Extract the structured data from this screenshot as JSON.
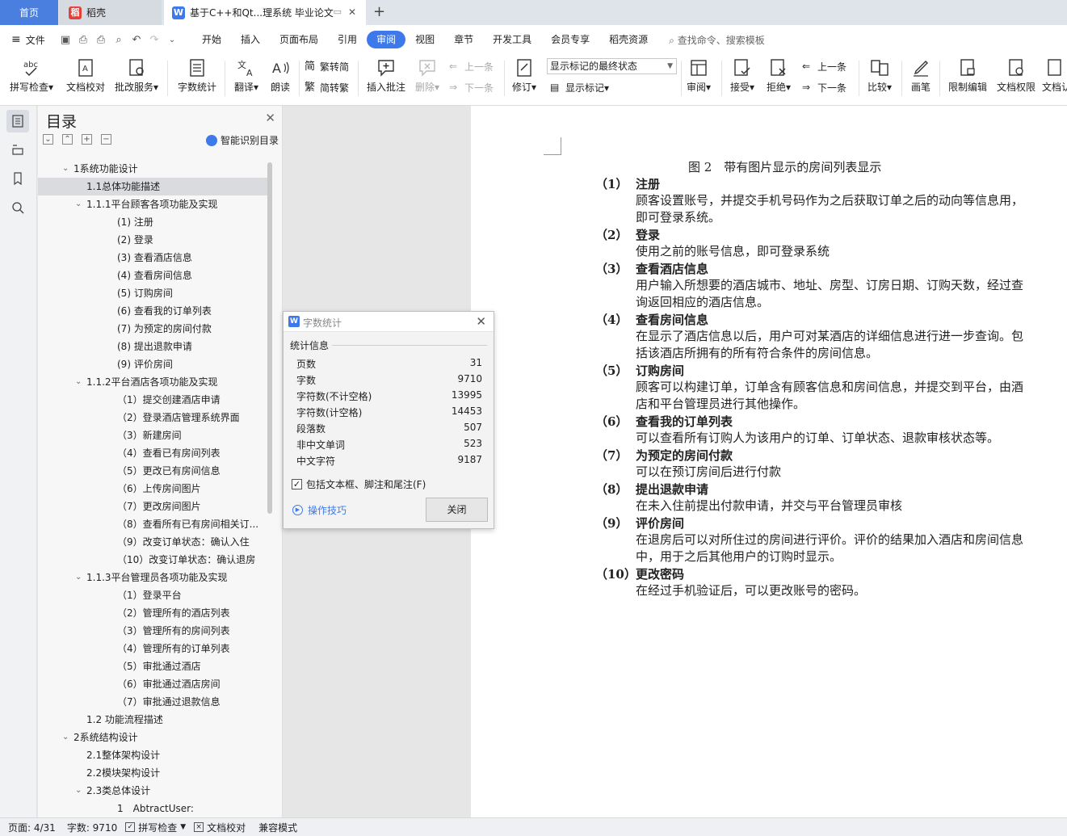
{
  "tabs": {
    "home": "首页",
    "daoke": "稻壳",
    "doc": "基于C++和Qt...理系统 毕业论文"
  },
  "menu": {
    "file": "文件",
    "tabs": [
      "开始",
      "插入",
      "页面布局",
      "引用",
      "审阅",
      "视图",
      "章节",
      "开发工具",
      "会员专享",
      "稻壳资源"
    ],
    "active_tab": "审阅",
    "search": "查找命令、搜索模板"
  },
  "ribbon": {
    "spellcheck": "拼写检查",
    "proofread": "文档校对",
    "annotate_service": "批改服务",
    "word_count": "字数统计",
    "translate": "翻译",
    "read_aloud": "朗读",
    "to_traditional": "繁转简",
    "to_simplified": "简转繁",
    "insert_comment": "插入批注",
    "delete": "删除",
    "prev": "上一条",
    "next": "下一条",
    "track": "修订",
    "markup_state": "显示标记的最终状态",
    "show_markup": "显示标记",
    "review": "审阅",
    "accept": "接受",
    "reject": "拒绝",
    "prev2": "上一条",
    "next2": "下一条",
    "compare": "比较",
    "pen": "画笔",
    "restrict": "限制编辑",
    "permission": "文档权限",
    "doc_more": "文档认"
  },
  "nav": {
    "title": "目录",
    "smart": "智能识别目录",
    "items": [
      {
        "text": "1系统功能设计",
        "level": 0,
        "toggle": "v"
      },
      {
        "text": "1.1总体功能描述",
        "level": 1,
        "toggle": "",
        "selected": true
      },
      {
        "text": "1.1.1平台顾客各项功能及实现",
        "level": 1,
        "toggle": "v"
      },
      {
        "text": "(1) 注册",
        "level": 2,
        "toggle": ""
      },
      {
        "text": "(2) 登录",
        "level": 2,
        "toggle": ""
      },
      {
        "text": "(3) 查看酒店信息",
        "level": 2,
        "toggle": ""
      },
      {
        "text": "(4) 查看房间信息",
        "level": 2,
        "toggle": ""
      },
      {
        "text": "(5) 订购房间",
        "level": 2,
        "toggle": ""
      },
      {
        "text": "(6) 查看我的订单列表",
        "level": 2,
        "toggle": ""
      },
      {
        "text": "(7) 为预定的房间付款",
        "level": 2,
        "toggle": ""
      },
      {
        "text": "(8) 提出退款申请",
        "level": 2,
        "toggle": ""
      },
      {
        "text": "(9) 评价房间",
        "level": 2,
        "toggle": ""
      },
      {
        "text": "1.1.2平台酒店各项功能及实现",
        "level": 1,
        "toggle": "v"
      },
      {
        "text": "（1）提交创建酒店申请",
        "level": 2,
        "toggle": ""
      },
      {
        "text": "（2）登录酒店管理系统界面",
        "level": 2,
        "toggle": ""
      },
      {
        "text": "（3）新建房间",
        "level": 2,
        "toggle": ""
      },
      {
        "text": "（4）查看已有房间列表",
        "level": 2,
        "toggle": ""
      },
      {
        "text": "（5）更改已有房间信息",
        "level": 2,
        "toggle": ""
      },
      {
        "text": "（6）上传房间图片",
        "level": 2,
        "toggle": ""
      },
      {
        "text": "（7）更改房间图片",
        "level": 2,
        "toggle": ""
      },
      {
        "text": "（8）查看所有已有房间相关订...",
        "level": 2,
        "toggle": ""
      },
      {
        "text": "（9）改变订单状态：确认入住",
        "level": 2,
        "toggle": ""
      },
      {
        "text": "（10）改变订单状态：确认退房",
        "level": 2,
        "toggle": ""
      },
      {
        "text": "1.1.3平台管理员各项功能及实现",
        "level": 1,
        "toggle": "v"
      },
      {
        "text": "（1）登录平台",
        "level": 2,
        "toggle": ""
      },
      {
        "text": "（2）管理所有的酒店列表",
        "level": 2,
        "toggle": ""
      },
      {
        "text": "（3）管理所有的房间列表",
        "level": 2,
        "toggle": ""
      },
      {
        "text": "（4）管理所有的订单列表",
        "level": 2,
        "toggle": ""
      },
      {
        "text": "（5）审批通过酒店",
        "level": 2,
        "toggle": ""
      },
      {
        "text": "（6）审批通过酒店房间",
        "level": 2,
        "toggle": ""
      },
      {
        "text": "（7）审批通过退款信息",
        "level": 2,
        "toggle": ""
      },
      {
        "text": "1.2 功能流程描述",
        "level": 1,
        "toggle": ""
      },
      {
        "text": "2系统结构设计",
        "level": 0,
        "toggle": "v"
      },
      {
        "text": "2.1整体架构设计",
        "level": 1,
        "toggle": ""
      },
      {
        "text": "2.2模块架构设计",
        "level": 1,
        "toggle": ""
      },
      {
        "text": "2.3类总体设计",
        "level": 1,
        "toggle": "v"
      },
      {
        "text": "1　AbtractUser:",
        "level": 2,
        "toggle": ""
      }
    ]
  },
  "document": {
    "caption": "图 2　带有图片显示的房间列表显示",
    "items": [
      {
        "num": "（1）",
        "head": "注册",
        "body": "顾客设置账号，并提交手机号码作为之后获取订单之后的动向等信息用，即可登录系统。"
      },
      {
        "num": "（2）",
        "head": "登录",
        "body": "使用之前的账号信息，即可登录系统"
      },
      {
        "num": "（3）",
        "head": "查看酒店信息",
        "body": "用户输入所想要的酒店城市、地址、房型、订房日期、订购天数，经过查询返回相应的酒店信息。"
      },
      {
        "num": "（4）",
        "head": "查看房间信息",
        "body": "在显示了酒店信息以后，用户可对某酒店的详细信息进行进一步查询。包括该酒店所拥有的所有符合条件的房间信息。"
      },
      {
        "num": "（5）",
        "head": "订购房间",
        "body": "顾客可以构建订单，订单含有顾客信息和房间信息，并提交到平台，由酒店和平台管理员进行其他操作。"
      },
      {
        "num": "（6）",
        "head": "查看我的订单列表",
        "body": "可以查看所有订购人为该用户的订单、订单状态、退款审核状态等。"
      },
      {
        "num": "（7）",
        "head": "为预定的房间付款",
        "body": "可以在预订房间后进行付款"
      },
      {
        "num": "（8）",
        "head": "提出退款申请",
        "body": "在未入住前提出付款申请，并交与平台管理员审核"
      },
      {
        "num": "（9）",
        "head": "评价房间",
        "body": "在退房后可以对所住过的房间进行评价。评价的结果加入酒店和房间信息中，用于之后其他用户的订购时显示。"
      },
      {
        "num": "（10）",
        "head": "更改密码",
        "body": "在经过手机验证后，可以更改账号的密码。"
      }
    ]
  },
  "dialog": {
    "title": "字数统计",
    "section": "统计信息",
    "rows": [
      {
        "label": "页数",
        "value": "31"
      },
      {
        "label": "字数",
        "value": "9710"
      },
      {
        "label": "字符数(不计空格)",
        "value": "13995"
      },
      {
        "label": "字符数(计空格)",
        "value": "14453"
      },
      {
        "label": "段落数",
        "value": "507"
      },
      {
        "label": "非中文单词",
        "value": "523"
      },
      {
        "label": "中文字符",
        "value": "9187"
      }
    ],
    "checkbox_label": "包括文本框、脚注和尾注(F)",
    "checkbox_checked": true,
    "tips": "操作技巧",
    "close_button": "关闭"
  },
  "status": {
    "page": "页面: 4/31",
    "words": "字数: 9710",
    "spell": "拼写检查",
    "proof": "文档校对",
    "compat": "兼容模式"
  }
}
